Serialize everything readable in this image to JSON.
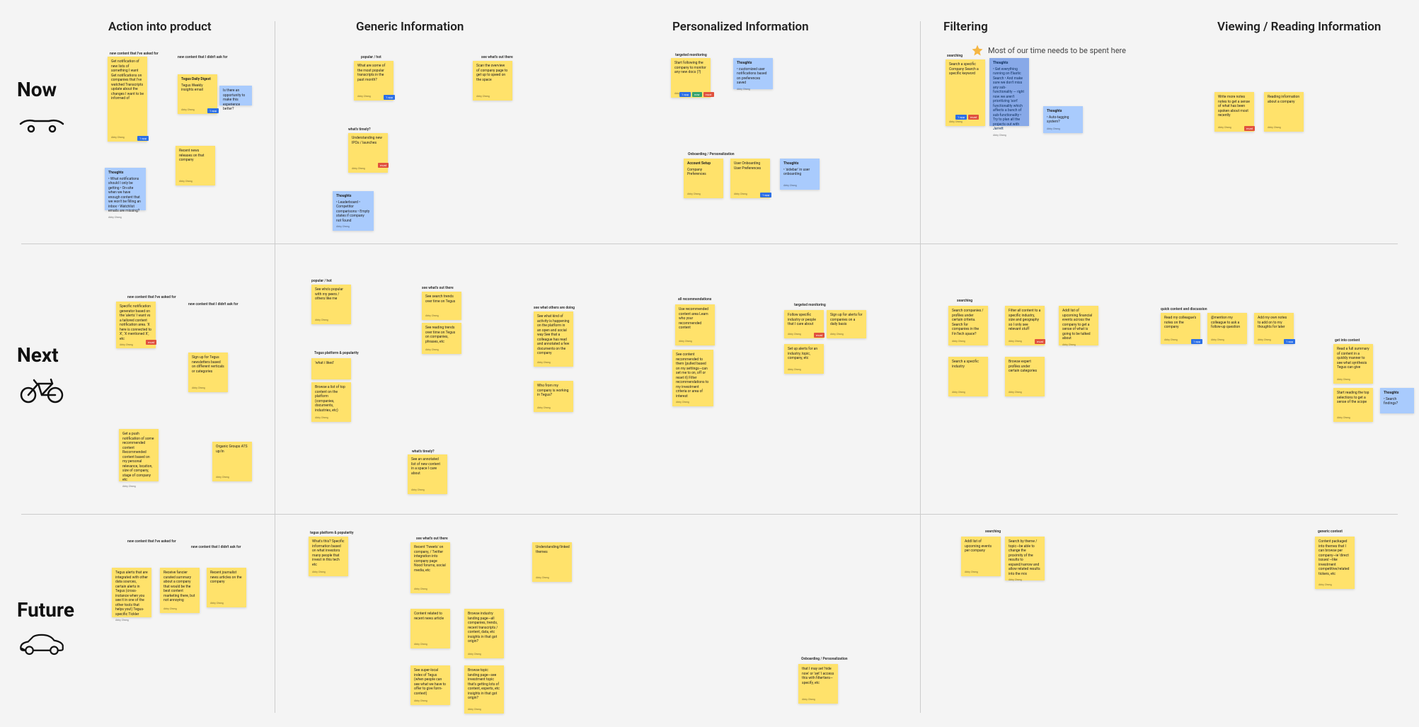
{
  "rows": {
    "now": {
      "label": "Now"
    },
    "next": {
      "label": "Next"
    },
    "future": {
      "label": "Future"
    }
  },
  "columns": {
    "action": {
      "label": "Action into product"
    },
    "generic": {
      "label": "Generic Information"
    },
    "personal": {
      "label": "Personalized Information"
    },
    "filtering": {
      "label": "Filtering"
    },
    "viewing": {
      "label": "Viewing / Reading Information"
    }
  },
  "annotation": {
    "filtering_star": "Most of our time needs to be spent here"
  },
  "section_labels": {
    "now_action_asked": "new content that I've asked for",
    "now_action_notasked": "new content that I didn't ask for",
    "now_generic_popular": "popular / hot",
    "now_generic_whatsout": "see what's out there",
    "now_generic_pinned": "what's timely?",
    "now_personal_targeted": "targeted monitoring",
    "now_personal_onboard": "Onboarding / Personalization",
    "now_filtering_search": "searching",
    "next_action_asked": "new content that I've asked for",
    "next_action_notasked": "new content that I didn't ask for",
    "next_generic_popular": "popular / hot",
    "next_generic_whatsout": "see what's out there",
    "next_generic_platform": "Tegus platform & popularity",
    "next_generic_whoelse": "see what others are doing",
    "next_generic_timely": "what's timely?",
    "next_personal_allrec": "all recommendations",
    "next_personal_targeted": "targeted monitoring",
    "next_filtering_search": "searching",
    "next_viewing_quick": "quick content and discussion",
    "next_viewing_getctx": "get into content",
    "future_action_asked": "new content that I've asked for",
    "future_action_notasked": "new content that I didn't ask for",
    "future_generic_platpop": "tegus platform & popularity",
    "future_generic_whatsout": "see what's out there",
    "future_personal_onboard": "Onboarding / Personalization",
    "future_filtering_search": "searching",
    "future_viewing_generic": "generic context"
  },
  "notes": {
    "n_now_a1": {
      "body": "Get notification of new lists of something I want\n\nGet notifications on companies that I've watched\n\nTranscripts update about the changes I want to be informed of",
      "author": "Abby Chang"
    },
    "n_now_a2": {
      "header": "Thoughts",
      "body": "• What notifications should I only be getting\n• On-site when we have enough content that we won't be filling an inbox\n• Watchlist emails are missing?",
      "author": "Abby Chang"
    },
    "n_now_a3": {
      "header": "Tegus Daily Digest",
      "body": "Tegus Weekly insights email",
      "author": "Abby Chang"
    },
    "n_now_a4": {
      "body": "Is there an opportunity to make this experience better?"
    },
    "n_now_a5": {
      "body": "Recent news releases on that company",
      "author": "Abby Chang"
    },
    "n_now_g1": {
      "body": "What are some of the most popular transcripts in the past month?",
      "author": "Abby Chang"
    },
    "n_now_g2": {
      "body": "Scan the overview of company page to get up to speed on the space",
      "author": "Abby Chang"
    },
    "n_now_g3": {
      "body": "Understanding new IPOs / launches",
      "author": "Abby Chang"
    },
    "n_now_g4": {
      "header": "Thoughts",
      "body": "• Leaderboard\n• Competitor comparisons\n• Empty states if company not found",
      "author": "Abby Chang"
    },
    "n_now_p1": {
      "body": "Start following the company to monitor any new docs (?)",
      "author": "Abby Chang"
    },
    "n_now_p2": {
      "header": "Thoughts",
      "body": "• customized user notifications based on preferences saved",
      "author": "Abby Chang"
    },
    "n_now_p3": {
      "header": "Account Setup",
      "body": "Company Preferences",
      "author": "Abby Chang"
    },
    "n_now_p4": {
      "body": "User Onboarding\n\nUser Preferences",
      "author": "Abby Chang"
    },
    "n_now_p5": {
      "header": "Thoughts",
      "body": "• 'sidebar' in user onboarding",
      "author": "Abby Chang"
    },
    "n_now_f1": {
      "body": "Search a specific Company\n\nSearch a specific keyword",
      "author": "Abby Chang"
    },
    "n_now_f2": {
      "header": "Thoughts",
      "body": "• Get everything running on Elastic Search\n• And make sure we don't miss any sub-functionality — right now we aren't prioritizing 'sort' functionality which affects a bunch of sub-functionality\n• Try to plan all the projects out with Jarrett",
      "author": "Abby Chang"
    },
    "n_now_f3": {
      "header": "Thoughts",
      "body": "• Auto-tagging system?",
      "author": "Abby Chang"
    },
    "n_now_v1": {
      "body": "Write more notes notes to get a sense of what has been spoken about most recently",
      "author": "Abby Chang"
    },
    "n_now_v2": {
      "body": "Reading information about a company",
      "author": "Abby Chang"
    },
    "n_next_a1": {
      "body": "Specific notification generator based on the 'alerts' I want vs a tailored content notification area. 'X here is connected to X', 'X mentioned X', etc",
      "author": "Abby Chang"
    },
    "n_next_a2": {
      "body": "Sign up for Tegus newsletters based on different verticals or categories",
      "author": "Abby Chang"
    },
    "n_next_a3": {
      "body": "Get a push notification of some recommended content\n\nRecommended content based on my personal relevance, location, size of company, stage of company etc",
      "author": "Abby Chang"
    },
    "n_next_a4": {
      "body": "Organic Groups ATS up/in",
      "author": "Abby Chang"
    },
    "n_next_g1": {
      "body": "See who's popular with my peers / others like me",
      "author": "Abby Chang"
    },
    "n_next_g2": {
      "body": "'what i liked'",
      "author": "Abby Chang"
    },
    "n_next_g3": {
      "body": "Browse a list of top content on the platform (companies, documents, industries, etc)",
      "author": "Abby Chang"
    },
    "n_next_g4": {
      "body": "See search trends over time on Tegus",
      "author": "Abby Chang"
    },
    "n_next_g5": {
      "body": "See reading trends over time on Tegus on companies, phrases, etc",
      "author": "Abby Chang"
    },
    "n_next_g6": {
      "body": "See an annotated list of new content in a space I care about",
      "author": "Abby Chang"
    },
    "n_next_g7": {
      "body": "See what kind of activity is happening on the platform in an open and social way\n\nSee that a colleague has read and annotated a few documents on the company",
      "author": "Abby Chang"
    },
    "n_next_g8": {
      "body": "Who from my company is working in Tegus?",
      "author": "Abby Chang"
    },
    "n_next_p1": {
      "body": "Use recommended content area\n\nLearn who your recommended content",
      "author": "Abby Chang"
    },
    "n_next_p2": {
      "body": "See content recommended to them (pulled based on my settings—can set me to on, off or reset it)\n\nFilter recommendations to my investment criteria or area of interest",
      "author": "Abby Chang"
    },
    "n_next_p3": {
      "body": "Follow specific industry or people that I care about",
      "author": "Abby Chang"
    },
    "n_next_p4": {
      "body": "Sign up for alerts for companies on a daily basis",
      "author": "Abby Chang"
    },
    "n_next_p5": {
      "body": "Set up alerts for an industry, topic, company, etc",
      "author": "Abby Chang"
    },
    "n_next_f1": {
      "body": "Search companies / profiles under certain criteria. Search for companies in the FinTech space?",
      "author": "Abby Chang"
    },
    "n_next_f2": {
      "body": "Filter all content to a specific industry, size and geography so I only see relevant stuff",
      "author": "Abby Chang"
    },
    "n_next_f3": {
      "body": "Addl list of upcoming financial events across the company to get a sense of what is going to be talked about",
      "author": "Abby Chang"
    },
    "n_next_f4": {
      "body": "Search a specific industry",
      "author": "Abby Chang"
    },
    "n_next_f5": {
      "body": "Browse expert profiles under certain categories",
      "author": "Abby Chang"
    },
    "n_next_v1": {
      "body": "Read my colleague's notes on the company",
      "author": "Abby Chang"
    },
    "n_next_v2": {
      "body": "@mention my colleague to ask a follow-up question",
      "author": "Abby Chang"
    },
    "n_next_v3": {
      "body": "Add my own notes to add on to my thoughts for later",
      "author": "Abby Chang"
    },
    "n_next_v4": {
      "body": "Read a full summary of content in a quickly manner to see what synthesis Tegus can give",
      "author": "Abby Chang"
    },
    "n_next_v5": {
      "body": "Start reading the top selections to get a sense of the scope",
      "author": "Abby Chang"
    },
    "n_next_v6": {
      "header": "Thoughts",
      "body": "• Search findings?",
      "author": "Abby Chang"
    },
    "n_fut_a1": {
      "body": "Tegus alerts that are integrated with other data sources, certain alerts in Tegus (cross-instance when you see it in one of the other tools that helps you!)\n\nTegus-specific Tickler",
      "author": "Abby Chang"
    },
    "n_fut_a2": {
      "body": "Receive fancier curated summary about a company that would be the best content marketing there, but not annoying",
      "author": "Abby Chang"
    },
    "n_fut_a3": {
      "body": "Recent journalist news articles on the company",
      "author": "Abby Chang"
    },
    "n_fut_g1": {
      "body": "What's this? Specific information based on what investors many people that invest in this tech etc",
      "author": "Abby Chang"
    },
    "n_fut_g2": {
      "body": "Recent 'Tweets' on company, / Twitter integration into company page\n\nNood forums, social media, etc",
      "author": "Abby Chang"
    },
    "n_fut_g3": {
      "body": "Understanding/linked themes",
      "author": "Abby Chang"
    },
    "n_fut_g4": {
      "body": "Content related to recent news article",
      "author": "Abby Chang"
    },
    "n_fut_g5": {
      "body": "Browse industry landing page—all companies, trends, recent transcripts / content, data, etc\n\ninsights in that got origin?",
      "author": "Abby Chang"
    },
    "n_fut_g6": {
      "body": "See super-local index of Tegus (when people can see what we have to offer to give form-context)",
      "author": "Abby Chang"
    },
    "n_fut_g7": {
      "body": "Browse topic landing page—see investment topic that's getting lots of content, experts, etc\n\ninsights in that got origin?",
      "author": "Abby Chang"
    },
    "n_fut_p1": {
      "body": "that I may set 'hide now' or 'set' I access this with filtertiers—specify, etc",
      "author": "Abby Chang"
    },
    "n_fut_f1": {
      "body": "Addl list of upcoming events per company",
      "author": "Abby Chang"
    },
    "n_fut_f2": {
      "body": "Search by theme / topic—be able to change the proximity of the results to expand/narrow and allow related results into the mix",
      "author": "Abby Chang"
    },
    "n_fut_v1": {
      "body": "Content packaged into themes that I can browse per company—ie 'direct issues'—like investment competitive/related tickers, etc",
      "author": "Abby Chang"
    }
  },
  "tags": {
    "opp": "1 opp",
    "must": "must",
    "now": "now"
  }
}
